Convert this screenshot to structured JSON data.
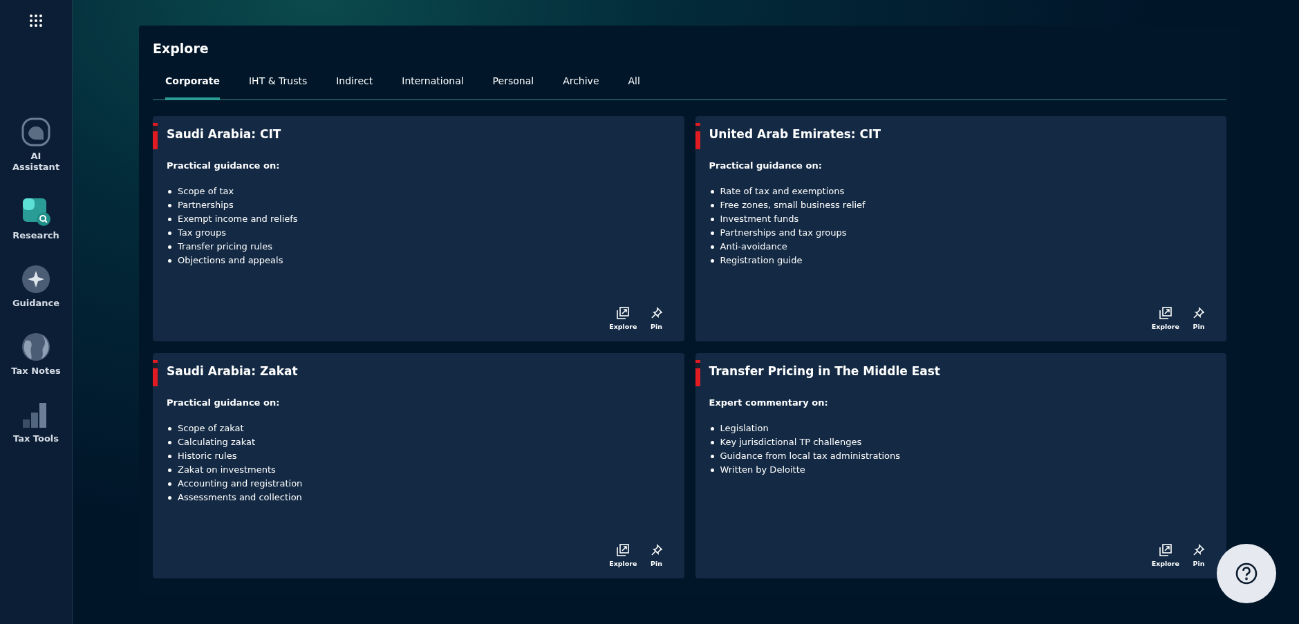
{
  "sidebar": {
    "items": [
      {
        "kind": "assistant",
        "label": "AI\nAssistant"
      },
      {
        "kind": "research",
        "label": "Research"
      },
      {
        "kind": "guidance",
        "label": "Guidance"
      },
      {
        "kind": "notes",
        "label": "Tax Notes"
      },
      {
        "kind": "tools",
        "label": "Tax Tools"
      }
    ]
  },
  "explore": {
    "title": "Explore",
    "tabs": [
      {
        "label": "Corporate",
        "selected": true
      },
      {
        "label": "IHT & Trusts",
        "selected": false
      },
      {
        "label": "Indirect",
        "selected": false
      },
      {
        "label": "International",
        "selected": false
      },
      {
        "label": "Personal",
        "selected": false
      },
      {
        "label": "Archive",
        "selected": false
      },
      {
        "label": "All",
        "selected": false
      }
    ],
    "cards": [
      {
        "title": "Saudi Arabia: CIT",
        "intro": "Practical guidance on:",
        "items": [
          "Scope of tax",
          "Partnerships",
          "Exempt income and reliefs",
          "Tax groups",
          "Transfer pricing rules",
          "Objections and appeals"
        ],
        "actions": [
          "Explore",
          "Pin"
        ]
      },
      {
        "title": "United Arab Emirates: CIT",
        "intro": "Practical guidance on:",
        "items": [
          "Rate of tax and exemptions",
          "Free zones, small business relief",
          "Investment funds",
          "Partnerships and tax groups",
          "Anti-avoidance",
          "Registration guide"
        ],
        "actions": [
          "Explore",
          "Pin"
        ]
      },
      {
        "title": "Saudi Arabia: Zakat",
        "intro": "Practical guidance on:",
        "items": [
          "Scope of zakat",
          "Calculating zakat",
          "Historic rules",
          "Zakat on investments",
          "Accounting and registration",
          "Assessments and collection"
        ],
        "actions": [
          "Explore",
          "Pin"
        ]
      },
      {
        "title": "Transfer Pricing in The Middle East",
        "intro": "Expert commentary on:",
        "items": [
          "Legislation",
          "Key jurisdictional TP challenges",
          "Guidance from local tax administrations",
          "Written by Deloitte"
        ],
        "actions": [
          "Explore",
          "Pin"
        ]
      }
    ]
  }
}
